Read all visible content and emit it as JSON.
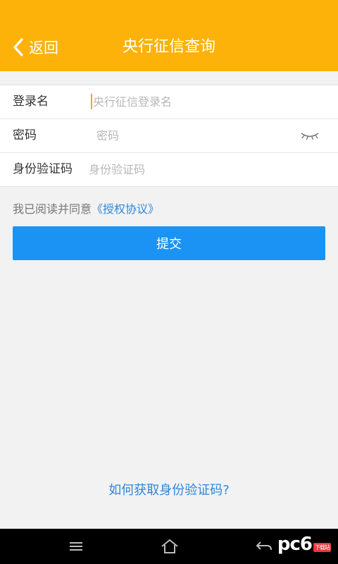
{
  "header": {
    "back_label": "返回",
    "title": "央行征信查询",
    "background": "#fdb20a"
  },
  "form": {
    "rows": [
      {
        "label": "登录名",
        "placeholder": "央行征信登录名",
        "value": ""
      },
      {
        "label": "密码",
        "placeholder": "密码",
        "value": ""
      },
      {
        "label": "身份验证码",
        "placeholder": "身份验证码",
        "value": ""
      }
    ],
    "password_toggle_icon": "eye-closed-icon"
  },
  "agreement": {
    "prefix": "我已阅读并同意",
    "link": "《授权协议》"
  },
  "submit_label": "提交",
  "help_link": "如何获取身份验证码?",
  "navbar": {
    "icons": [
      "menu-icon",
      "home-icon",
      "back-arrow-icon"
    ]
  },
  "watermark": {
    "text_pc": "pc",
    "text_6": "6",
    "sub": "下载站"
  },
  "colors": {
    "accent": "#fdb20a",
    "button": "#1a93f4",
    "link": "#2f86d8"
  }
}
